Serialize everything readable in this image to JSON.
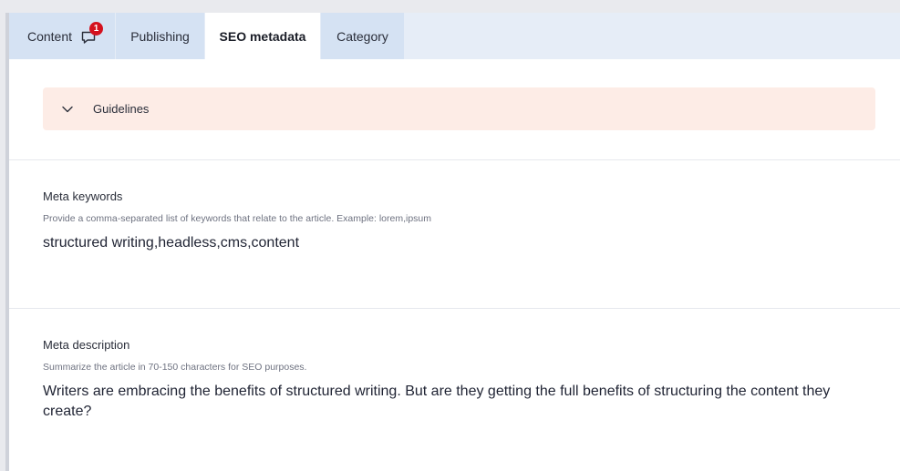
{
  "tabs": [
    {
      "label": "Content",
      "badge": "1",
      "active": false
    },
    {
      "label": "Publishing",
      "active": false
    },
    {
      "label": "SEO metadata",
      "active": true
    },
    {
      "label": "Category",
      "active": false
    }
  ],
  "guidelines": {
    "label": "Guidelines",
    "icon": "chevron-down-icon"
  },
  "meta_keywords": {
    "label": "Meta keywords",
    "help": "Provide a comma-separated list of keywords that relate to the article. Example: lorem,ipsum",
    "value": "structured writing,headless,cms,content"
  },
  "meta_description": {
    "label": "Meta description",
    "help": "Summarize the article in 70-150 characters for SEO purposes.",
    "value": "Writers are embracing the benefits of structured writing. But are they getting the full benefits of structuring the content they create?"
  },
  "colors": {
    "badge": "#d4111e",
    "tab_inactive": "#d5e2f3",
    "guidelines_bg": "#fdece6"
  }
}
